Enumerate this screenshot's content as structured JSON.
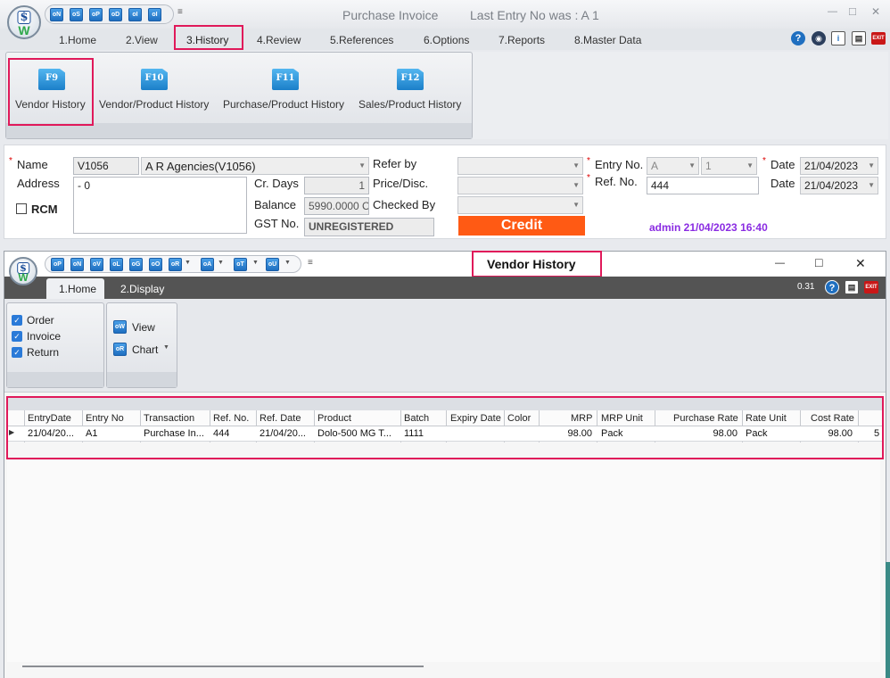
{
  "main": {
    "title": "Purchase Invoice",
    "last_entry": "Last Entry No was : A 1",
    "qat": [
      "oN",
      "oS",
      "oP",
      "oD",
      "oI",
      "oI"
    ],
    "tabs": [
      "1.Home",
      "2.View",
      "3.History",
      "4.Review",
      "5.References",
      "6.Options",
      "7.Reports",
      "8.Master Data"
    ],
    "history_buttons": [
      {
        "key": "F9",
        "label": "Vendor History"
      },
      {
        "key": "F10",
        "label": "Vendor/Product History"
      },
      {
        "key": "F11",
        "label": "Purchase/Product History"
      },
      {
        "key": "F12",
        "label": "Sales/Product History"
      }
    ],
    "win_min": "—",
    "win_max": "□",
    "win_close": "✕"
  },
  "form": {
    "name_label": "Name",
    "name_code": "V1056",
    "name_value": "A R Agencies(V1056)",
    "address_label": "Address",
    "address_value": "- 0",
    "rcm_label": "RCM",
    "cr_days_label": "Cr. Days",
    "cr_days_value": "1",
    "balance_label": "Balance",
    "balance_value": "5990.0000 C",
    "gst_label": "GST No.",
    "gst_value": "UNREGISTERED",
    "refer_by_label": "Refer by",
    "price_disc_label": "Price/Disc.",
    "checked_by_label": "Checked By",
    "credit_label": "Credit",
    "entry_no_label": "Entry No.",
    "entry_prefix": "A",
    "entry_no": "1",
    "ref_no_label": "Ref. No.",
    "ref_no_value": "444",
    "date_label": "Date",
    "date_value": "21/04/2023",
    "date2_label": "Date",
    "date2_value": "21/04/2023",
    "user_stamp": "admin 21/04/2023 16:40"
  },
  "vendor_window": {
    "title": "Vendor History",
    "qat": [
      "oP",
      "oN",
      "oV",
      "oL",
      "oG",
      "oO",
      "oR",
      "oA",
      "oT",
      "oU"
    ],
    "tabs": [
      "1.Home",
      "2.Display"
    ],
    "version": "0.31",
    "filters": [
      {
        "label": "Order",
        "checked": true
      },
      {
        "label": "Invoice",
        "checked": true
      },
      {
        "label": "Return",
        "checked": true
      }
    ],
    "view_label": "View",
    "chart_label": "Chart",
    "columns": [
      "EntryDate",
      "Entry No",
      "Transaction",
      "Ref. No.",
      "Ref. Date",
      "Product",
      "Batch",
      "Expiry Date",
      "Color",
      "MRP",
      "MRP Unit",
      "Purchase Rate",
      "Rate Unit",
      "Cost Rate"
    ],
    "rows": [
      [
        "21/04/20...",
        "A1",
        "Purchase In...",
        "444",
        "21/04/20...",
        "Dolo-500 MG T...",
        "1111",
        "",
        "",
        "98.00",
        "Pack",
        "98.00",
        "Pack",
        "98.00"
      ]
    ],
    "overflow_cell": "5"
  },
  "colors": {
    "accent_red": "#e0195a",
    "credit_bg": "#ff5a14",
    "user_stamp": "#8a2be2",
    "dark_tabbar": "#545454"
  }
}
